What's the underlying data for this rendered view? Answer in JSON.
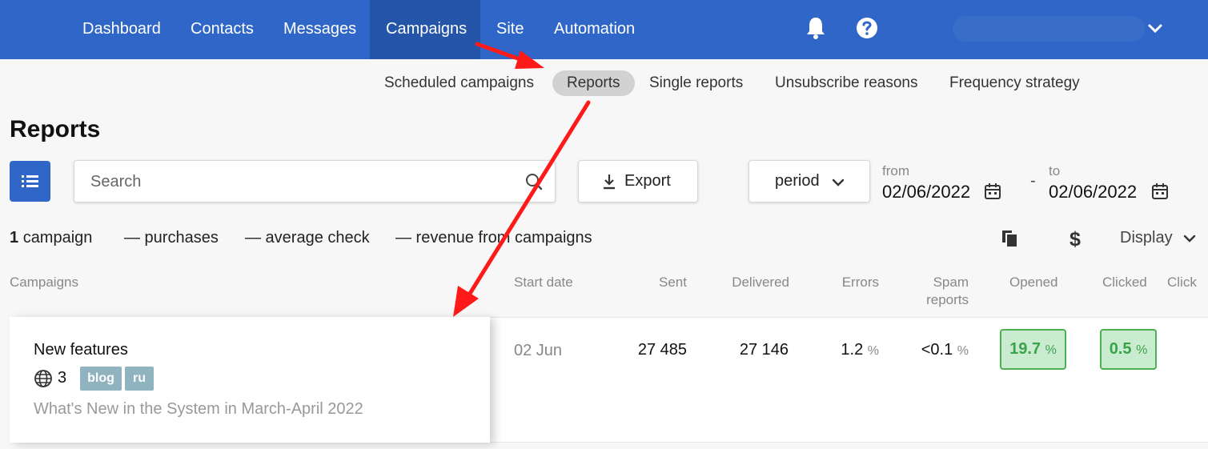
{
  "nav": {
    "items": [
      "Dashboard",
      "Contacts",
      "Messages",
      "Campaigns",
      "Site",
      "Automation"
    ],
    "active": "Campaigns",
    "icons": [
      "bell-icon",
      "help-icon",
      "chevron-down-icon"
    ]
  },
  "subnav": {
    "items": [
      "Scheduled campaigns",
      "Reports",
      "Single reports",
      "Unsubscribe reasons",
      "Frequency strategy"
    ],
    "active": "Reports"
  },
  "page": {
    "title": "Reports"
  },
  "toolbar": {
    "search_placeholder": "Search",
    "export_label": "Export",
    "period_label": "period",
    "from_label": "from",
    "from_value": "02/06/2022",
    "to_label": "to",
    "to_value": "02/06/2022",
    "dash": "-"
  },
  "summary": {
    "campaign_count": "1",
    "campaign_label": "campaign",
    "purchases": "— purchases",
    "average_check": "— average check",
    "revenue": "— revenue from campaigns",
    "display_label": "Display"
  },
  "table": {
    "headers": {
      "campaigns": "Campaigns",
      "start_date": "Start date",
      "sent": "Sent",
      "delivered": "Delivered",
      "errors": "Errors",
      "spam_1": "Spam",
      "spam_2": "reports",
      "opened": "Opened",
      "clicked": "Clicked",
      "clicks_cut": "Click"
    },
    "rows": [
      {
        "name": "New features",
        "site_count": "3",
        "tags": [
          "blog",
          "ru"
        ],
        "subject": "What's New in the System in March-April 2022",
        "start_date": "02 Jun",
        "sent": "27 485",
        "delivered": "27 146",
        "errors": "1.2",
        "spam": "<0.1",
        "opened": "19.7",
        "clicked": "0.5",
        "pct_sign": "%"
      }
    ]
  },
  "colors": {
    "nav_bg": "#2f66c8",
    "nav_active": "#2455a9",
    "accent_green": "#4caf50",
    "tag_bg": "#8fb3bf",
    "annotation_arrow": "#ff1a1a"
  }
}
